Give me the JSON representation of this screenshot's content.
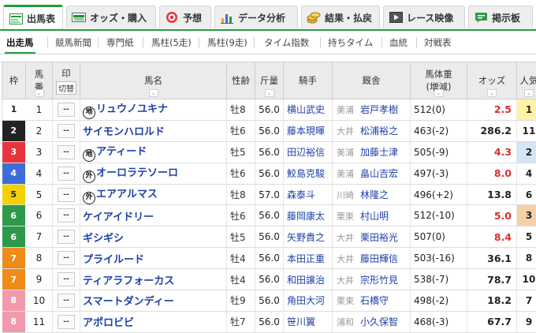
{
  "tabs": [
    {
      "label": "出馬表",
      "icon": "race-card-icon",
      "active": true
    },
    {
      "label": "オッズ・購入",
      "icon": "ticket-icon",
      "active": false
    },
    {
      "label": "予想",
      "icon": "target-icon",
      "active": false
    },
    {
      "label": "データ分析",
      "icon": "bar-chart-icon",
      "active": false
    },
    {
      "label": "結果・払戻",
      "icon": "coins-icon",
      "active": false
    },
    {
      "label": "レース映像",
      "icon": "video-icon",
      "active": false
    },
    {
      "label": "掲示板",
      "icon": "chat-icon",
      "active": false
    }
  ],
  "subnav": [
    "出走馬",
    "競馬新聞",
    "専門紙",
    "馬柱(5走)",
    "馬柱(9走)",
    "タイム指数",
    "持ちタイム",
    "血統",
    "対戦表"
  ],
  "headers": {
    "waku": "枠",
    "uma1": "馬",
    "uma2": "番",
    "mark1": "印",
    "mark2": "切替",
    "name": "馬名",
    "sex": "性齢",
    "weight": "斤量",
    "jockey": "騎手",
    "trainer": "厩舎",
    "bw1": "馬体重",
    "bw2": "(増減)",
    "odds": "オッズ",
    "pop": "人気"
  },
  "mark_placeholder": "--",
  "arrow_glyph": "⌄",
  "horses": [
    {
      "waku": "1",
      "num": "1",
      "badge": "地",
      "name": "リュウノユキナ",
      "sex": "牡8",
      "wt": "56.0",
      "jockey": "横山武史",
      "area": "美浦",
      "trainer": "岩戸孝樹",
      "bw": "512(0)",
      "odds": "2.5",
      "pop": "1"
    },
    {
      "waku": "2",
      "num": "2",
      "badge": "",
      "name": "サイモンハロルド",
      "sex": "牡6",
      "wt": "56.0",
      "jockey": "藤本現暉",
      "area": "大井",
      "trainer": "松浦裕之",
      "bw": "463(-2)",
      "odds": "286.2",
      "pop": "11"
    },
    {
      "waku": "3",
      "num": "3",
      "badge": "地",
      "name": "アティード",
      "sex": "牡5",
      "wt": "56.0",
      "jockey": "田辺裕信",
      "area": "美浦",
      "trainer": "加藤士津",
      "bw": "505(-9)",
      "odds": "4.3",
      "pop": "2"
    },
    {
      "waku": "4",
      "num": "4",
      "badge": "外",
      "name": "オーロラテソーロ",
      "sex": "牡6",
      "wt": "56.0",
      "jockey": "鮫島克駿",
      "area": "美浦",
      "trainer": "畠山吉宏",
      "bw": "497(-3)",
      "odds": "8.0",
      "pop": "4"
    },
    {
      "waku": "5",
      "num": "5",
      "badge": "外",
      "name": "エアアルマス",
      "sex": "牡8",
      "wt": "57.0",
      "jockey": "森泰斗",
      "area": "川崎",
      "trainer": "林隆之",
      "bw": "496(+2)",
      "odds": "13.8",
      "pop": "6"
    },
    {
      "waku": "6",
      "num": "6",
      "badge": "",
      "name": "ケイアイドリー",
      "sex": "牡6",
      "wt": "56.0",
      "jockey": "藤岡康太",
      "area": "栗東",
      "trainer": "村山明",
      "bw": "512(-10)",
      "odds": "5.0",
      "pop": "3"
    },
    {
      "waku": "6",
      "num": "7",
      "badge": "",
      "name": "ギシギシ",
      "sex": "牡5",
      "wt": "56.0",
      "jockey": "矢野貴之",
      "area": "大井",
      "trainer": "栗田裕光",
      "bw": "507(0)",
      "odds": "8.4",
      "pop": "5"
    },
    {
      "waku": "7",
      "num": "8",
      "badge": "",
      "name": "プライルード",
      "sex": "牡4",
      "wt": "56.0",
      "jockey": "本田正重",
      "area": "大井",
      "trainer": "藤田輝信",
      "bw": "503(-16)",
      "odds": "36.1",
      "pop": "8"
    },
    {
      "waku": "7",
      "num": "9",
      "badge": "",
      "name": "ティアラフォーカス",
      "sex": "牡4",
      "wt": "56.0",
      "jockey": "和田譲治",
      "area": "大井",
      "trainer": "宗形竹見",
      "bw": "538(-7)",
      "odds": "78.7",
      "pop": "10"
    },
    {
      "waku": "8",
      "num": "10",
      "badge": "",
      "name": "スマートダンディー",
      "sex": "牡9",
      "wt": "56.0",
      "jockey": "角田大河",
      "area": "栗東",
      "trainer": "石橋守",
      "bw": "498(-2)",
      "odds": "18.2",
      "pop": "7"
    },
    {
      "waku": "8",
      "num": "11",
      "badge": "",
      "name": "アポロビビ",
      "sex": "牡7",
      "wt": "56.0",
      "jockey": "笹川翼",
      "area": "浦和",
      "trainer": "小久保智",
      "bw": "468(-3)",
      "odds": "67.7",
      "pop": "9"
    }
  ],
  "colors": {
    "accent": "#1e9d3a",
    "horse_link": "#1d3fa6",
    "odds_hot": "#d82f2f"
  }
}
